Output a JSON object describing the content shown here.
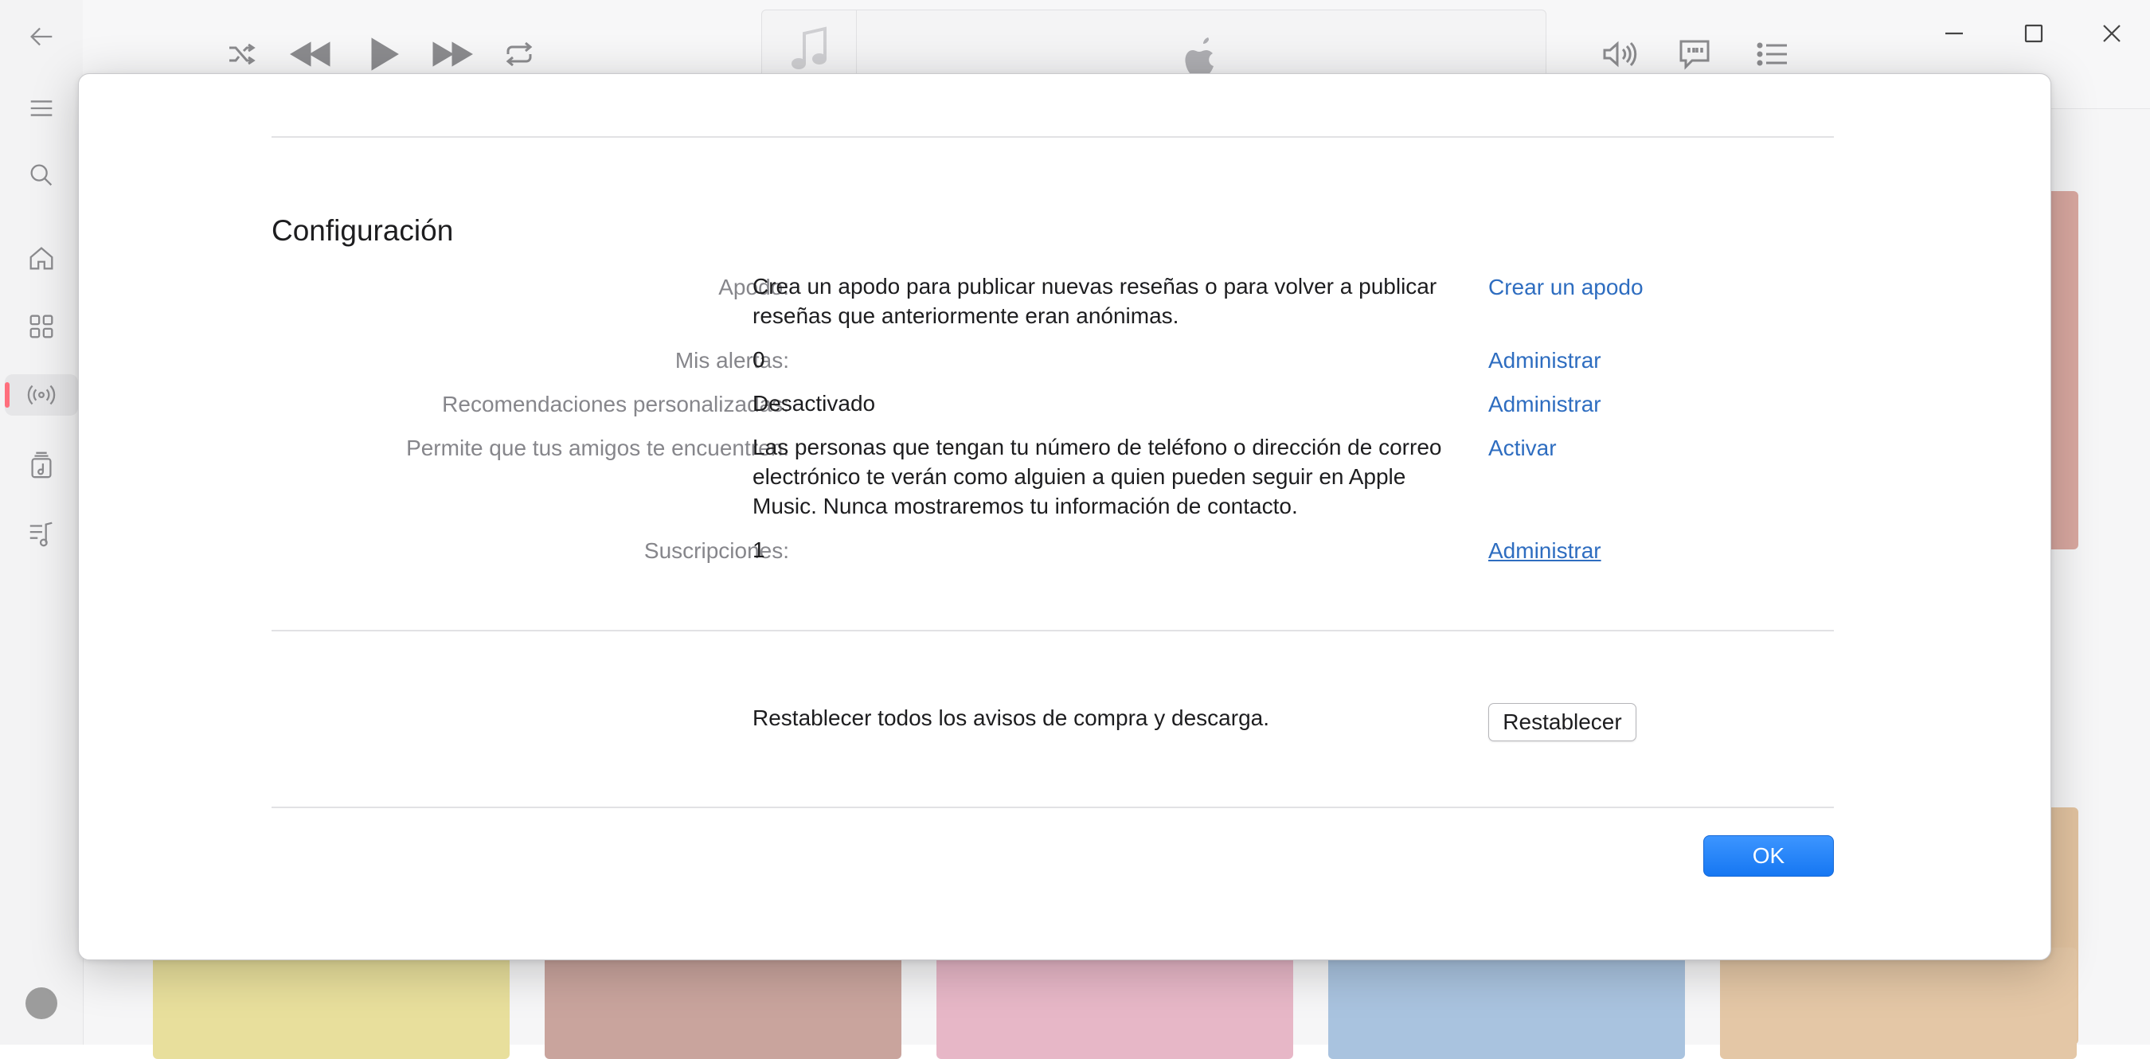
{
  "toolbar": {
    "icons": [
      "back-arrow-icon",
      "shuffle-icon",
      "rewind-icon",
      "play-icon",
      "fast-forward-icon",
      "repeat-icon",
      "music-note-icon",
      "apple-logo-icon",
      "volume-icon",
      "lyrics-icon",
      "queue-list-icon"
    ]
  },
  "sidebar": {
    "icons": [
      "menu-icon",
      "search-icon",
      "home-icon",
      "browse-icon",
      "radio-icon",
      "library-icon",
      "playlist-icon"
    ],
    "active_item": "radio-icon"
  },
  "dialog": {
    "section_title": "Configuración",
    "rows": [
      {
        "label": "Apodo:",
        "value": "Crea un apodo para publicar nuevas reseñas o para volver a publicar reseñas que anteriormente eran anónimas.",
        "action": "Crear un apodo"
      },
      {
        "label": "Mis alertas:",
        "value": "0",
        "action": "Administrar"
      },
      {
        "label": "Recomendaciones personalizadas:",
        "value": "Desactivado",
        "action": "Administrar"
      },
      {
        "label": "Permite que tus amigos te encuentren:",
        "value": "Las personas que tengan tu número de teléfono o dirección de correo electrónico te verán como alguien a quien pueden seguir en Apple Music. Nunca mostraremos tu información de contacto.",
        "action": "Activar"
      },
      {
        "label": "Suscripciones:",
        "value": "1",
        "action": "Administrar"
      }
    ],
    "reset": {
      "text": "Restablecer todos los avisos de compra y descarga.",
      "button": "Restablecer"
    },
    "ok_button": "OK"
  },
  "colors": {
    "link": "#2e6dc0",
    "ok_button": "#1a7cf5",
    "active_indicator": "#ff6f7d"
  }
}
